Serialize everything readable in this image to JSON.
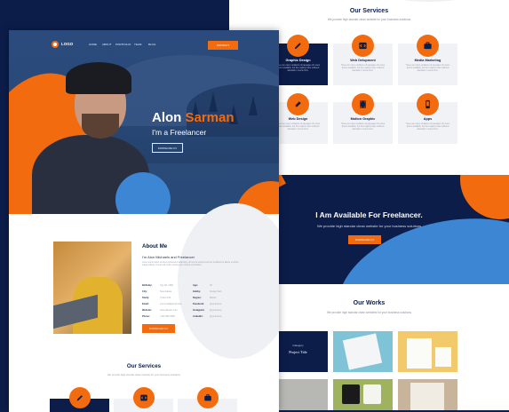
{
  "colors": {
    "navy": "#0c1d4a",
    "orange": "#f26b0f",
    "blue": "#3d86d3",
    "light_gray": "#f1f2f6"
  },
  "right_page": {
    "services_title": "Our Services",
    "services_sub": "We provide high standar clean website for your business solutions",
    "services": [
      {
        "title": "Graphic Design",
        "icon": "pen-icon",
        "desc": "There are many variations of passages of Lorem Ipsum available, but the majority have suffered alteration in some form."
      },
      {
        "title": "Web Delopment",
        "icon": "code-icon",
        "desc": "There are many variations of passages of Lorem Ipsum available, but the majority have suffered alteration in some form."
      },
      {
        "title": "Media Marketing",
        "icon": "briefcase-icon",
        "desc": "There are many variations of passages of Lorem Ipsum available, but the majority have suffered alteration in some form."
      },
      {
        "title": "Web Design",
        "icon": "pencil-icon",
        "desc": "There are many variations of passages of Lorem Ipsum available, but the majority have suffered alteration in some form."
      },
      {
        "title": "Motion Graphic",
        "icon": "film-icon",
        "desc": "There are many variations of passages of Lorem Ipsum available, but the majority have suffered alteration in some form."
      },
      {
        "title": "Apps",
        "icon": "phone-icon",
        "desc": "There are many variations of passages of Lorem Ipsum available, but the majority have suffered alteration in some form."
      }
    ],
    "freelance_title": "I Am Available For Freelancer.",
    "freelance_sub": "We provide high standar clean website for your business solutions",
    "freelance_button": "DOWNLOAD CV",
    "works_title": "Our Works",
    "works_sub": "We provide high standar clean websites for your business solutions",
    "first_work": {
      "category": "Category",
      "title": "Project Title"
    }
  },
  "left_page": {
    "logo_text": "LOGO",
    "nav": [
      "HOME",
      "ABOUT",
      "PORTFOLIO",
      "TEAM",
      "BLOG"
    ],
    "contact_button": "CONTACT",
    "hero_first_name": "Alon",
    "hero_last_name": "Sarman",
    "hero_role": "I'm a Freelancer",
    "hero_button": "DOWNLOAD CV",
    "about_title": "About Me",
    "about_hello": "I'm Alon Michaels and Freelancer",
    "about_desc": "Lorem ipsum dolor sit amet consectetur adipiscing elit sed do eiusmod tempor incididunt ut labore et dolore magna aliqua. Ut enim ad minim veniam quis nostrud exercitation.",
    "info_left": [
      {
        "k": "Birthday:",
        "v": "July 06, 1990"
      },
      {
        "k": "City:",
        "v": "New Alaska"
      },
      {
        "k": "Study:",
        "v": "Yocket 123"
      },
      {
        "k": "Email:",
        "v": "youremail@gmail.com"
      },
      {
        "k": "Website:",
        "v": "www.domain.com"
      },
      {
        "k": "Phone:",
        "v": "+123 456 7890"
      }
    ],
    "info_right": [
      {
        "k": "Age:",
        "v": "29"
      },
      {
        "k": "Hobby:",
        "v": "Design Web"
      },
      {
        "k": "Degree:",
        "v": "Master"
      },
      {
        "k": "Facebook:",
        "v": "@yourname"
      },
      {
        "k": "Instagram:",
        "v": "@yourname"
      },
      {
        "k": "LinkedIn:",
        "v": "@yourname"
      }
    ],
    "about_button": "DOWNLOAD CV",
    "services_title": "Our Services",
    "services_sub": "We provide high standar clean website for your business solutions"
  }
}
